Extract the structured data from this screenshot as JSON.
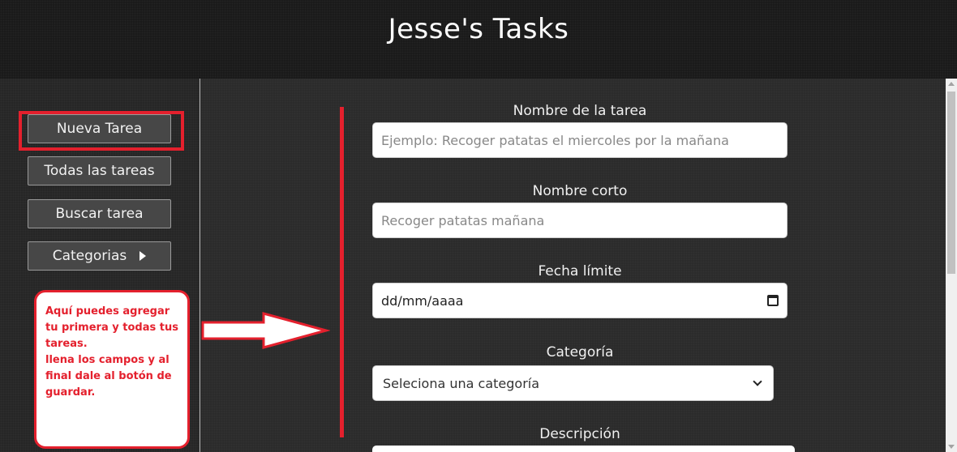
{
  "header": {
    "title": "Jesse's Tasks"
  },
  "sidebar": {
    "items": [
      {
        "label": "Nueva Tarea"
      },
      {
        "label": "Todas las tareas"
      },
      {
        "label": "Buscar tarea"
      },
      {
        "label": "Categorias",
        "icon": "caret-right-icon"
      }
    ]
  },
  "note": {
    "line1": "Aquí puedes agregar tu primera y todas tus tareas.",
    "line2": "llena los campos y al final dale al botón de guardar."
  },
  "form": {
    "name": {
      "label": "Nombre de la tarea",
      "placeholder": "Ejemplo: Recoger patatas el miercoles por la mañana"
    },
    "short": {
      "label": "Nombre corto",
      "placeholder": "Recoger patatas mañana"
    },
    "date": {
      "label": "Fecha límite",
      "placeholder": "dd/mm/aaaa",
      "icon": "calendar-icon"
    },
    "category": {
      "label": "Categoría",
      "selected": "Seleciona una categoría",
      "icon": "chevron-down-icon"
    },
    "description": {
      "label": "Descripción"
    }
  },
  "colors": {
    "accent": "#e4202d",
    "header_bg": "#1a1a1a",
    "button_bg": "#474747"
  }
}
